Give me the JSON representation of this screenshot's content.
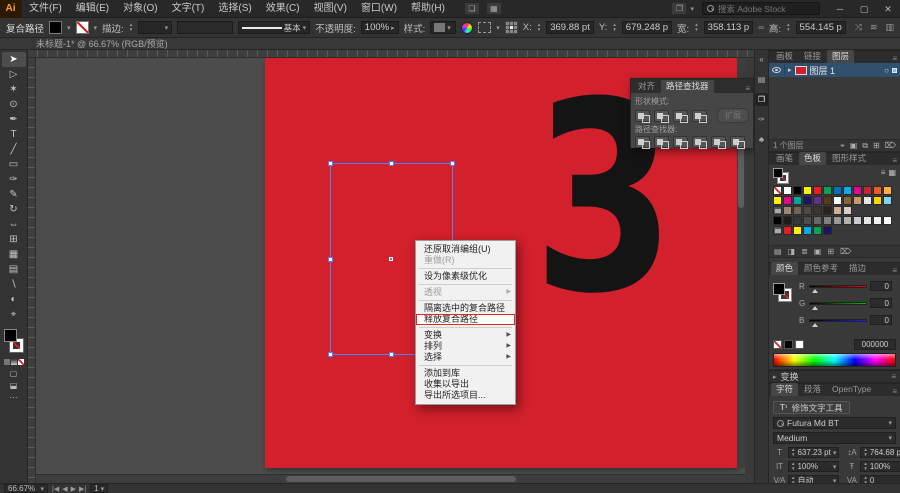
{
  "colors": {
    "canvas_red": "#d2202c",
    "highlight_red": "#e8252a",
    "selection_blue": "#4d82ff"
  },
  "titlebar": {
    "logo": "Ai",
    "menus": [
      "文件(F)",
      "编辑(E)",
      "对象(O)",
      "文字(T)",
      "选择(S)",
      "效果(C)",
      "视图(V)",
      "窗口(W)",
      "帮助(H)"
    ],
    "icons": [
      {
        "name": "share-button",
        "glyph": "❏"
      },
      {
        "name": "arrange-documents-button",
        "glyph": "▦"
      }
    ],
    "workspace_glyph": "❐",
    "search_placeholder": "搜索 Adobe Stock",
    "window_buttons": [
      {
        "name": "minimize-button",
        "glyph": "─"
      },
      {
        "name": "maximize-button",
        "glyph": "▢"
      },
      {
        "name": "close-button",
        "glyph": "✕"
      }
    ]
  },
  "optionsbar": {
    "context_label": "复合路径",
    "stroke_label": "描边:",
    "brush_value": "基本",
    "opacity_label": "不透明度:",
    "opacity_value": "100%",
    "style_label": "样式:",
    "x_label": "X:",
    "x_value": "369.88 pt",
    "y_label": "Y:",
    "y_value": "679.248 p",
    "w_label": "宽:",
    "w_value": "358.113 p",
    "h_label": "高:",
    "h_value": "554.145 p"
  },
  "document": {
    "tab_title": "未标题-1* @ 66.67% (RGB/预览)",
    "numeral": "3"
  },
  "tools": [
    {
      "name": "selection-tool",
      "glyph": "➤",
      "active": true
    },
    {
      "name": "direct-selection-tool",
      "glyph": "▷"
    },
    {
      "name": "magic-wand-tool",
      "glyph": "✶"
    },
    {
      "name": "lasso-tool",
      "glyph": "⊙"
    },
    {
      "name": "pen-tool",
      "glyph": "✒"
    },
    {
      "name": "type-tool",
      "glyph": "T"
    },
    {
      "name": "line-segment-tool",
      "glyph": "╱"
    },
    {
      "name": "rectangle-tool",
      "glyph": "▭"
    },
    {
      "name": "paintbrush-tool",
      "glyph": "✑"
    },
    {
      "name": "pencil-tool",
      "glyph": "✎"
    },
    {
      "name": "rotate-tool",
      "glyph": "↻"
    },
    {
      "name": "scale-tool",
      "glyph": "⇔"
    },
    {
      "name": "shape-builder-tool",
      "glyph": "⊞"
    },
    {
      "name": "mesh-tool",
      "glyph": "▦"
    },
    {
      "name": "gradient-tool",
      "glyph": "▤"
    },
    {
      "name": "eyedropper-tool",
      "glyph": "∖"
    },
    {
      "name": "blend-tool",
      "glyph": "◐"
    },
    {
      "name": "zoom-tool",
      "glyph": "⌖"
    }
  ],
  "toolbar_bottom": [
    {
      "name": "draw-normal-mode-button",
      "glyph": "▢"
    },
    {
      "name": "screen-mode-button",
      "glyph": "⬓"
    },
    {
      "name": "more-tools-button",
      "glyph": "⋯"
    }
  ],
  "context_menu": {
    "items": [
      {
        "label": "还原取消编组(U)"
      },
      {
        "label": "重做(R)",
        "disabled": true
      },
      {
        "sep": true
      },
      {
        "label": "设为像素级优化"
      },
      {
        "sep": true
      },
      {
        "label": "透视",
        "disabled": true,
        "submenu": true
      },
      {
        "sep": true
      },
      {
        "label": "隔离选中的复合路径"
      },
      {
        "label": "释放复合路径",
        "highlight": true
      },
      {
        "sep": true
      },
      {
        "label": "变换",
        "submenu": true
      },
      {
        "label": "排列",
        "submenu": true
      },
      {
        "label": "选择",
        "submenu": true
      },
      {
        "sep": true
      },
      {
        "label": "添加到库"
      },
      {
        "label": "收集以导出"
      },
      {
        "label": "导出所选项目..."
      }
    ]
  },
  "pathfinder_panel": {
    "tabs": [
      "对齐",
      "路径查找器"
    ],
    "active_tab": 1,
    "shape_modes_label": "形状模式:",
    "shape_mode_buttons": [
      "unite",
      "minus-front",
      "intersect",
      "exclude"
    ],
    "expand_label": "扩展",
    "pathfinder_label": "路径查找器:",
    "pathfinder_buttons": [
      "divide",
      "trim",
      "merge",
      "crop",
      "outline",
      "minus-back"
    ]
  },
  "dock_icons": [
    {
      "name": "collapse-dock-icon",
      "glyph": "«"
    },
    {
      "name": "color-panel-icon",
      "glyph": "▤"
    },
    {
      "name": "swatches-panel-icon",
      "glyph": "❐",
      "active": true
    },
    {
      "name": "brushes-panel-icon",
      "glyph": "✑"
    },
    {
      "name": "symbols-panel-icon",
      "glyph": "♣"
    }
  ],
  "layers_panel": {
    "tabs": [
      "画板",
      "链接",
      "图层"
    ],
    "active_tab": 2,
    "row_label": "图层 1",
    "count_label": "1 个图层",
    "foot_icons": [
      {
        "name": "locate-object-icon",
        "glyph": "⌖"
      },
      {
        "name": "make-clipping-mask-icon",
        "glyph": "▣"
      },
      {
        "name": "new-sublayer-icon",
        "glyph": "⧉"
      },
      {
        "name": "new-layer-icon",
        "glyph": "⊞"
      },
      {
        "name": "delete-layer-icon",
        "glyph": "⌦"
      }
    ]
  },
  "swatches_panel": {
    "tabs": [
      "画笔",
      "色板",
      "图形样式"
    ],
    "active_tab": 1,
    "rows": [
      [
        "none",
        "#ffffff",
        "#000000",
        "#fff200",
        "#ed1c24",
        "#00a651",
        "#0072bc",
        "#00aeef",
        "#ec008c",
        "#c1272d",
        "#f15a24",
        "#fbb03b"
      ],
      [
        "#fff200",
        "#ec008c",
        "#00a99d",
        "#1b1464",
        "#662d91",
        "#603813",
        "#ffffff",
        "#8c6239",
        "#c69c6d",
        "#e6e6e6",
        "#ffd400",
        "#7fd4f2"
      ],
      [
        "group",
        "#998675",
        "#736357",
        "#534741",
        "#3f312b",
        "#2b211c",
        "#c7b299",
        "#d9cfc5"
      ],
      [
        "#000000",
        "#1c1c1c",
        "#363636",
        "#4d4d4d",
        "#666666",
        "#808080",
        "#999999",
        "#b3b3b3",
        "#cccccc",
        "#e6e6e6",
        "#f2f2f2",
        "#ffffff"
      ],
      [
        "group",
        "#ed1c24",
        "#fff200",
        "#00aeef",
        "#00a651",
        "#1b1464"
      ]
    ],
    "foot_icons": [
      {
        "name": "swatch-libraries-icon",
        "glyph": "▤"
      },
      {
        "name": "color-themes-icon",
        "glyph": "◨"
      },
      {
        "name": "swatch-kinds-icon",
        "glyph": "≣"
      },
      {
        "name": "new-color-group-icon",
        "glyph": "▣"
      },
      {
        "name": "new-swatch-icon",
        "glyph": "⊞"
      },
      {
        "name": "delete-swatch-icon",
        "glyph": "⌦"
      }
    ]
  },
  "color_panel": {
    "tabs": [
      "颜色",
      "颜色参考",
      "描边"
    ],
    "active_tab": 0,
    "sliders": [
      {
        "label": "R",
        "value": "0",
        "color": "#ff0000"
      },
      {
        "label": "G",
        "value": "0",
        "color": "#00c000"
      },
      {
        "label": "B",
        "value": "0",
        "color": "#2020ff"
      }
    ],
    "hex_value": "000000"
  },
  "transform_panel": {
    "title": "变换"
  },
  "character_panel": {
    "tabs": [
      "字符",
      "段落",
      "OpenType"
    ],
    "active_tab": 0,
    "touch_type_label": "修饰文字工具",
    "font_name": "Futura Md BT",
    "font_style": "Medium",
    "fields": [
      {
        "name": "font-size-field",
        "icon": "T",
        "value": "637.23 pt"
      },
      {
        "name": "leading-field",
        "icon": "↕A",
        "value": "764.68 pt"
      },
      {
        "name": "vertical-scale-field",
        "icon": "IT",
        "value": "100%"
      },
      {
        "name": "horizontal-scale-field",
        "icon": "Ŧ",
        "value": "100%"
      },
      {
        "name": "kerning-field",
        "icon": "V∕A",
        "value": "自动"
      },
      {
        "name": "tracking-field",
        "icon": "VA",
        "value": "0"
      }
    ]
  },
  "statusbar": {
    "zoom_value": "66.67%",
    "artboard_value": "1",
    "nav_icons": [
      {
        "name": "first-artboard-icon",
        "glyph": "|◀"
      },
      {
        "name": "prev-artboard-icon",
        "glyph": "◀"
      },
      {
        "name": "next-artboard-icon",
        "glyph": "▶"
      },
      {
        "name": "last-artboard-icon",
        "glyph": "▶|"
      }
    ]
  }
}
